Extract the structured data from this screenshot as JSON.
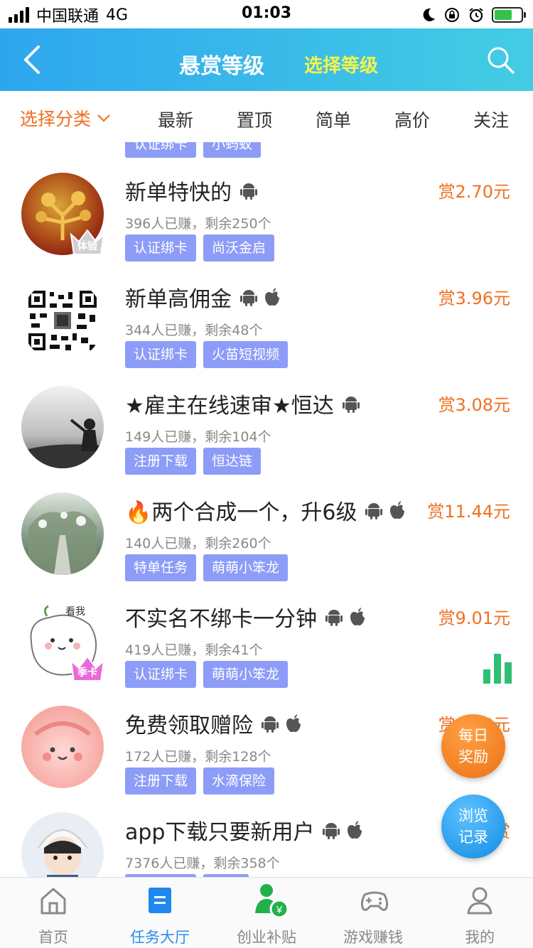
{
  "status_bar": {
    "carrier": "中国联通",
    "network": "4G",
    "time": "01:03"
  },
  "header": {
    "title": "悬赏等级",
    "select_level": "选择等级"
  },
  "category_bar": {
    "select_label": "选择分类",
    "tabs": [
      "最新",
      "置顶",
      "简单",
      "高价",
      "关注"
    ]
  },
  "partial_top_row": {
    "tags": [
      "认证绑卡",
      "小蚂蚁"
    ]
  },
  "tasks": [
    {
      "title": "新单特快的",
      "platforms": [
        "android"
      ],
      "reward": "赏2.70元",
      "stats": "396人已赚，剩余250个",
      "tags": [
        "认证绑卡",
        "尚沃金启"
      ],
      "badge": "体验"
    },
    {
      "title": "新单高佣金",
      "platforms": [
        "android",
        "apple"
      ],
      "reward": "赏3.96元",
      "stats": "344人已赚，剩余48个",
      "tags": [
        "认证绑卡",
        "火苗短视频"
      ],
      "badge": ""
    },
    {
      "title": "★雇主在线速审★恒达",
      "platforms": [
        "android"
      ],
      "reward": "赏3.08元",
      "stats": "149人已赚，剩余104个",
      "tags": [
        "注册下载",
        "恒达链"
      ],
      "badge": ""
    },
    {
      "title": "🔥两个合成一个，升6级",
      "platforms": [
        "android",
        "apple"
      ],
      "reward": "赏11.44元",
      "stats": "140人已赚，剩余260个",
      "tags": [
        "特单任务",
        "萌萌小笨龙"
      ],
      "badge": ""
    },
    {
      "title": "不实名不绑卡一分钟",
      "platforms": [
        "android",
        "apple"
      ],
      "reward": "赏9.01元",
      "stats": "419人已赚，剩余41个",
      "tags": [
        "认证绑卡",
        "萌萌小笨龙"
      ],
      "badge": "季卡",
      "avatar_text": "看我"
    },
    {
      "title": "免费领取赠险",
      "platforms": [
        "android",
        "apple"
      ],
      "reward": "赏9.08元",
      "stats": "172人已赚，剩余128个",
      "tags": [
        "注册下载",
        "水滴保险"
      ],
      "badge": ""
    },
    {
      "title": "app下载只要新用户",
      "platforms": [
        "android",
        "apple"
      ],
      "reward": "赏",
      "stats": "7376人已赚，剩余358个",
      "tags": [
        "",
        ""
      ],
      "badge": ""
    }
  ],
  "floating": {
    "daily_reward": [
      "每日",
      "奖励"
    ],
    "browse_history": [
      "浏览",
      "记录"
    ]
  },
  "bottom_nav": {
    "items": [
      {
        "label": "首页",
        "icon": "home-icon",
        "active": false
      },
      {
        "label": "任务大厅",
        "icon": "task-hall-icon",
        "active": true
      },
      {
        "label": "创业补贴",
        "icon": "subsidy-icon",
        "active": false
      },
      {
        "label": "游戏赚钱",
        "icon": "gamepad-icon",
        "active": false
      },
      {
        "label": "我的",
        "icon": "profile-icon",
        "active": false
      }
    ]
  },
  "colors": {
    "header_start": "#2ea6ef",
    "header_end": "#43cde3",
    "accent_orange": "#f07022",
    "select_level_yellow": "#f4f44a",
    "tag_purple": "#8d9cf7",
    "active_blue": "#2a8ef0",
    "chart_green": "#2fbf74"
  }
}
